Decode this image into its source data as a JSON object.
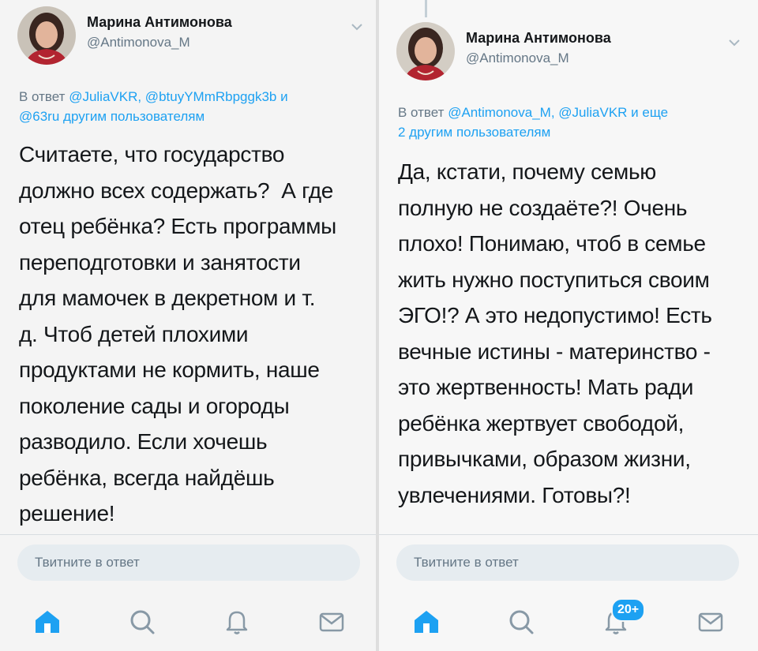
{
  "left": {
    "author": {
      "name": "Марина Антимонова",
      "handle": "@Antimonova_M"
    },
    "reply_prefix": "В ответ",
    "reply_mentions_1": "@JuliaVKR, @btuyYMmRbpggk3b",
    "reply_and": "и",
    "reply_mentions_2": "@63ru",
    "reply_suffix": "другим пользователям",
    "text_lines": [
      "Считаете, что государство",
      "должно всех содержать?  А где",
      "отец ребёнка? Есть программы",
      "переподготовки и занятости",
      "для мамочек в декретном и т.",
      "д. Чтоб детей плохими",
      "продуктами не кормить, наше",
      "поколение сады и огороды",
      "разводило. Если хочешь",
      "ребёнка, всегда найдёшь",
      "решение!"
    ],
    "reply_placeholder": "Твитните в ответ",
    "nav": {
      "icons": [
        "home-icon",
        "search-icon",
        "notifications-icon",
        "messages-icon"
      ]
    }
  },
  "right": {
    "author": {
      "name": "Марина Антимонова",
      "handle": "@Antimonova_M"
    },
    "reply_prefix": "В ответ",
    "reply_mentions_1": "@Antimonova_M, @JuliaVKR и еще",
    "reply_mentions_2": "2 другим пользователям",
    "text_lines": [
      "Да, кстати, почему семью",
      "полную не создаёте?! Очень",
      "плохо! Понимаю, чтоб в семье",
      "жить нужно поступиться своим",
      "ЭГО!? А это недопустимо! Есть",
      "вечные истины - материнство -",
      "это жертвенность! Мать ради",
      "ребёнка жертвует свободой,",
      "привычками, образом жизни,",
      "увлечениями. Готовы?!"
    ],
    "reply_placeholder": "Твитните в ответ",
    "notifications_badge": "20+",
    "nav": {
      "icons": [
        "home-icon",
        "search-icon",
        "notifications-icon",
        "messages-icon"
      ]
    }
  },
  "colors": {
    "accent": "#1da1f2",
    "text": "#14171a",
    "muted": "#657786",
    "reply_bg": "#e6ecf0"
  }
}
